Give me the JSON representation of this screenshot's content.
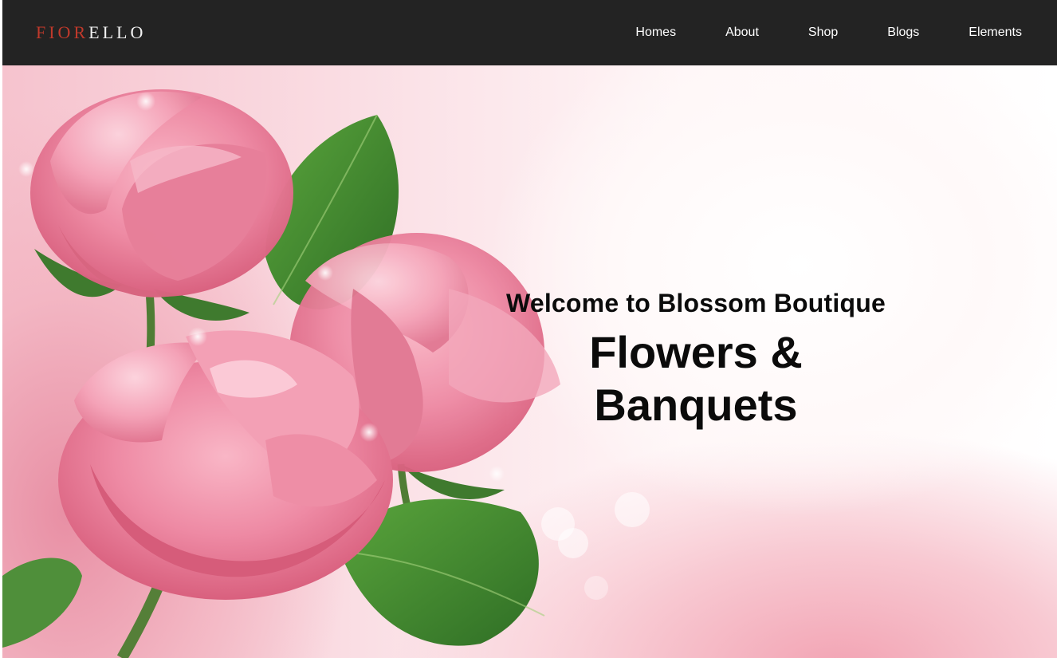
{
  "brand": {
    "logo_part1": "FIOR",
    "logo_part2": "ELLO",
    "accent_color": "#c0392b"
  },
  "nav": {
    "items": [
      {
        "label": "Homes"
      },
      {
        "label": "About"
      },
      {
        "label": "Shop"
      },
      {
        "label": "Blogs"
      },
      {
        "label": "Elements"
      }
    ],
    "background": "#232323"
  },
  "hero": {
    "subtitle": "Welcome to Blossom Boutique",
    "title": "Flowers & Banquets",
    "image": "pink-roses-illustration"
  }
}
